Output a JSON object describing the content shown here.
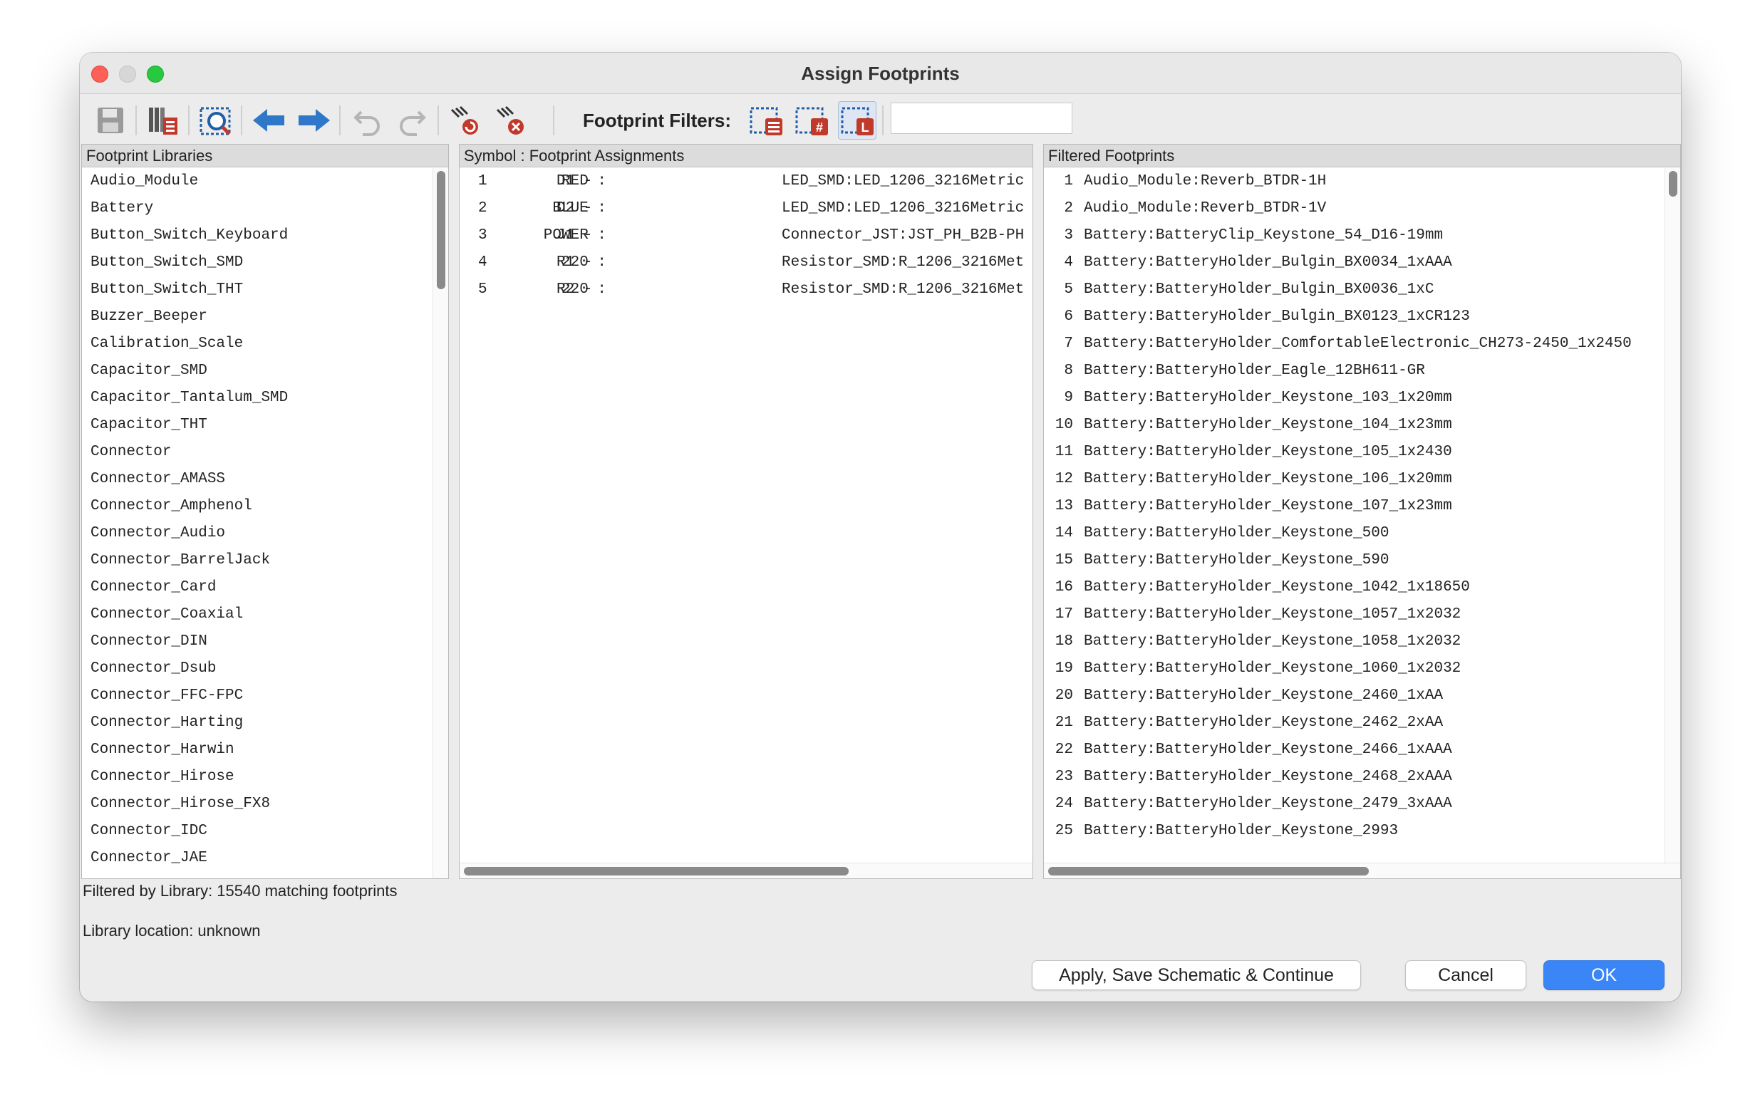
{
  "window": {
    "title": "Assign Footprints"
  },
  "toolbar": {
    "filters_label": "Footprint Filters:",
    "filter_value": ""
  },
  "libraries": {
    "header": "Footprint Libraries",
    "items": [
      "Audio_Module",
      "Battery",
      "Button_Switch_Keyboard",
      "Button_Switch_SMD",
      "Button_Switch_THT",
      "Buzzer_Beeper",
      "Calibration_Scale",
      "Capacitor_SMD",
      "Capacitor_Tantalum_SMD",
      "Capacitor_THT",
      "Connector",
      "Connector_AMASS",
      "Connector_Amphenol",
      "Connector_Audio",
      "Connector_BarrelJack",
      "Connector_Card",
      "Connector_Coaxial",
      "Connector_DIN",
      "Connector_Dsub",
      "Connector_FFC-FPC",
      "Connector_Harting",
      "Connector_Harwin",
      "Connector_Hirose",
      "Connector_Hirose_FX8",
      "Connector_IDC",
      "Connector_JAE"
    ]
  },
  "assignments": {
    "header": "Symbol : Footprint Assignments",
    "rows": [
      {
        "num": "1",
        "ref": "D1 -",
        "value": "RED :",
        "footprint": "LED_SMD:LED_1206_3216Metric"
      },
      {
        "num": "2",
        "ref": "D2 -",
        "value": "BLUE :",
        "footprint": "LED_SMD:LED_1206_3216Metric"
      },
      {
        "num": "3",
        "ref": "J1 -",
        "value": "POWER :",
        "footprint": "Connector_JST:JST_PH_B2B-PH"
      },
      {
        "num": "4",
        "ref": "R1 -",
        "value": "220 :",
        "footprint": "Resistor_SMD:R_1206_3216Met"
      },
      {
        "num": "5",
        "ref": "R2 -",
        "value": "220 :",
        "footprint": "Resistor_SMD:R_1206_3216Met"
      }
    ]
  },
  "filtered": {
    "header": "Filtered Footprints",
    "rows": [
      {
        "num": "1",
        "name": "Audio_Module:Reverb_BTDR-1H"
      },
      {
        "num": "2",
        "name": "Audio_Module:Reverb_BTDR-1V"
      },
      {
        "num": "3",
        "name": "Battery:BatteryClip_Keystone_54_D16-19mm"
      },
      {
        "num": "4",
        "name": "Battery:BatteryHolder_Bulgin_BX0034_1xAAA"
      },
      {
        "num": "5",
        "name": "Battery:BatteryHolder_Bulgin_BX0036_1xC"
      },
      {
        "num": "6",
        "name": "Battery:BatteryHolder_Bulgin_BX0123_1xCR123"
      },
      {
        "num": "7",
        "name": "Battery:BatteryHolder_ComfortableElectronic_CH273-2450_1x2450"
      },
      {
        "num": "8",
        "name": "Battery:BatteryHolder_Eagle_12BH611-GR"
      },
      {
        "num": "9",
        "name": "Battery:BatteryHolder_Keystone_103_1x20mm"
      },
      {
        "num": "10",
        "name": "Battery:BatteryHolder_Keystone_104_1x23mm"
      },
      {
        "num": "11",
        "name": "Battery:BatteryHolder_Keystone_105_1x2430"
      },
      {
        "num": "12",
        "name": "Battery:BatteryHolder_Keystone_106_1x20mm"
      },
      {
        "num": "13",
        "name": "Battery:BatteryHolder_Keystone_107_1x23mm"
      },
      {
        "num": "14",
        "name": "Battery:BatteryHolder_Keystone_500"
      },
      {
        "num": "15",
        "name": "Battery:BatteryHolder_Keystone_590"
      },
      {
        "num": "16",
        "name": "Battery:BatteryHolder_Keystone_1042_1x18650"
      },
      {
        "num": "17",
        "name": "Battery:BatteryHolder_Keystone_1057_1x2032"
      },
      {
        "num": "18",
        "name": "Battery:BatteryHolder_Keystone_1058_1x2032"
      },
      {
        "num": "19",
        "name": "Battery:BatteryHolder_Keystone_1060_1x2032"
      },
      {
        "num": "20",
        "name": "Battery:BatteryHolder_Keystone_2460_1xAA"
      },
      {
        "num": "21",
        "name": "Battery:BatteryHolder_Keystone_2462_2xAA"
      },
      {
        "num": "22",
        "name": "Battery:BatteryHolder_Keystone_2466_1xAAA"
      },
      {
        "num": "23",
        "name": "Battery:BatteryHolder_Keystone_2468_2xAAA"
      },
      {
        "num": "24",
        "name": "Battery:BatteryHolder_Keystone_2479_3xAAA"
      },
      {
        "num": "25",
        "name": "Battery:BatteryHolder_Keystone_2993"
      }
    ]
  },
  "status": {
    "filtered_by": "Filtered by Library: 15540 matching footprints",
    "library_location": "Library location: unknown"
  },
  "buttons": {
    "apply": "Apply, Save Schematic & Continue",
    "cancel": "Cancel",
    "ok": "OK"
  }
}
